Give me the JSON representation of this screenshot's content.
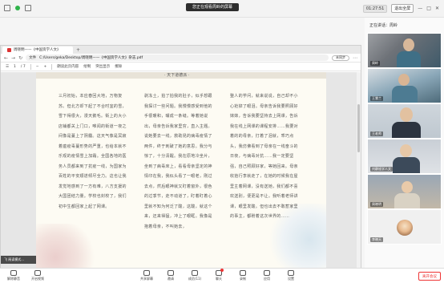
{
  "topbar": {
    "share_banner": "您正在观看周岭的屏幕",
    "time": "01:27:51",
    "exit_fullscreen": "退出全屏",
    "minimize": "—",
    "maximize": "□",
    "close": "✕"
  },
  "browser": {
    "tab_title": "周晓明——《中国资学人文》",
    "new_tab": "+",
    "url_prefix": "文件",
    "url_path": "C:/Users/geka/Desktop/周晓明——《中国资学人文》杂志.pdf",
    "profile": "未同步",
    "page_current": "1",
    "page_total": "/ 7",
    "tools": [
      "朗读此页内容",
      "绘制",
      "突出显示",
      "擦除"
    ],
    "zoom": "+"
  },
  "pdf": {
    "page_header": "· 天下道德派 ·",
    "columns": [
      "三月初始，本应春回大地，万物复苏。但北方却下起了不合时宜的雪，雪下得很大，漫天鹅毛。街上的大小店铺都关上门口，唯闻的街道一夜之间像是蔓上了阴霾。这天气像是冥寂着瘟疫毒蔓形势的严重，也给本就不乐观的疫情雪上加霜。全国各地的医务人员都来到了抗疫一线，为国家为百姓的平安顺遂倾尽全力。这也让我发觉地感到了一方有难，八方支援的大国团结力量。学校也封校了，我们初中生都回家上起了网课。",
      "剥冻土，拍了拍我的肚子，似乎想跟我探讨一些问题。我慢慢感受到他的手很暖和，嘴成一条缝。等着她说出，母亲告诉我家里穷，直入主题。说她要去一线，救助昆的病毒疫情了两件，终于刺破了她的意思。我分与惊了，十分清醒。我在原地冷坐片，坐到了病毒床上，看看母亲坚定的神情印在我，我似头看了一眼老，刚过去点，然后眼神就又盯着窗外，很色的过季节，走不动道了，盯着盯着心里就不知为何泛了酸，这酸，就这个来，还来得猛，冲上了眼眶。我像是抱着母亲，不叫她去，",
      "整人的学问，就来说说，自己却不小心抢掉了眼泪。母亲告诉我要照顾好妹妹，告诉我要坚持去上网课，告诉我在线上网课的课程安排……我要对着的的母亲，打着了泪就，乖巧点头，我仿佛看到了母亲在一线奋斗的日夜，与病毒对抗……我一定要坚强，自己照顾好家，等她回来。母亲收拾行李就走了，在她的时候我在屋里主着网课，没有送她，我们都不喜欢送别，便更是不让。我听着老师讲课，眼里发酸。但也出去不敢惹家里的事主，都盼着这次世界的……"
    ],
    "side_tag": "飞 阅读模式..."
  },
  "participants": {
    "header": "正在讲话：周岭",
    "list": [
      {
        "name": "周岭"
      },
      {
        "name": "王慧兰"
      },
      {
        "name": "王老师"
      },
      {
        "name": "刘静娅学人文"
      },
      {
        "name": "周晓明"
      },
      {
        "name": "李晓天"
      }
    ]
  },
  "footer": {
    "buttons": [
      {
        "label": "解除静音",
        "icon": "mic-icon"
      },
      {
        "label": "开启视频",
        "icon": "camera-icon"
      },
      {
        "label": "共享屏幕",
        "icon": "share-screen-icon"
      },
      {
        "label": "邀请",
        "icon": "invite-icon"
      },
      {
        "label": "成员(11)",
        "icon": "members-icon"
      },
      {
        "label": "聊天",
        "icon": "chat-icon"
      },
      {
        "label": "录制",
        "icon": "record-icon"
      },
      {
        "label": "应用",
        "icon": "apps-icon"
      },
      {
        "label": "设置",
        "icon": "settings-icon"
      }
    ],
    "leave_meeting": "离开会议"
  },
  "colors": {
    "accent_red": "#e33333",
    "active_green": "#2fb34a",
    "page_bg": "#fdfbf3"
  }
}
